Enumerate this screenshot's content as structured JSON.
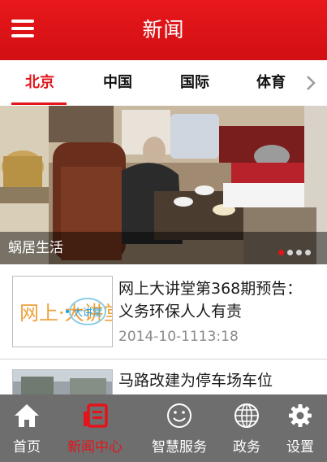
{
  "header": {
    "title": "新闻",
    "menu_icon": "hamburger-menu-icon"
  },
  "tabs": {
    "items": [
      {
        "label": "北京",
        "active": true
      },
      {
        "label": "中国",
        "active": false
      },
      {
        "label": "国际",
        "active": false
      },
      {
        "label": "体育",
        "active": false
      }
    ],
    "more_icon": "chevron-right-icon"
  },
  "banner": {
    "caption": "蜗居生活",
    "slide_count": 4,
    "current_slide": 1
  },
  "news": [
    {
      "title": "网上大讲堂第368期预告：义务环保人人有责",
      "time": "2014-10-1113:18",
      "thumb_text": "网上·大讲堂"
    },
    {
      "title": "马路改建为停车场车位"
    }
  ],
  "bottom_nav": {
    "items": [
      {
        "label": "首页",
        "icon": "home-icon",
        "active": false
      },
      {
        "label": "新闻中心",
        "icon": "news-icon",
        "active": true
      },
      {
        "label": "智慧服务",
        "icon": "smiley-icon",
        "active": false
      },
      {
        "label": "政务",
        "icon": "globe-icon",
        "active": false
      },
      {
        "label": "设置",
        "icon": "gear-icon",
        "active": false
      }
    ]
  },
  "colors": {
    "accent": "#e3141a",
    "header": "#d10f12",
    "nav_bg": "#6e6e6e"
  }
}
